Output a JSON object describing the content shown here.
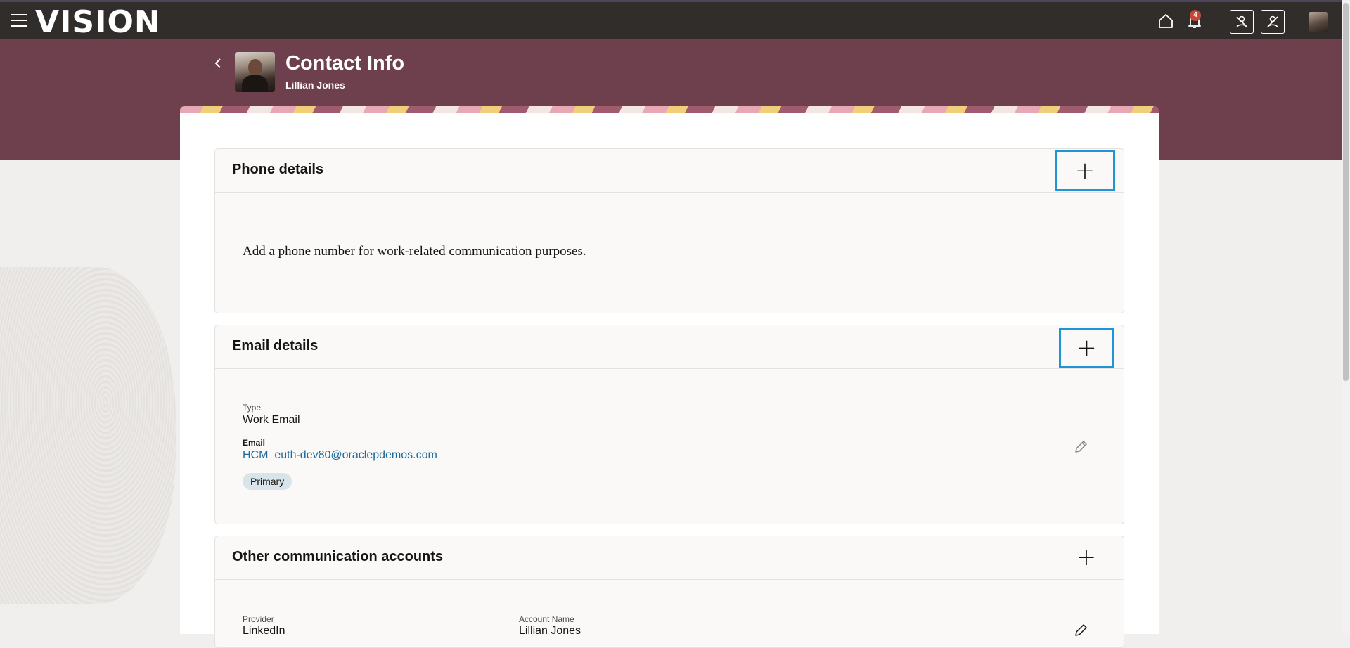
{
  "app": {
    "logo": "VISION",
    "notification_count": "4"
  },
  "header": {
    "title": "Contact Info",
    "person_name": "Lillian Jones"
  },
  "phone": {
    "section_title": "Phone details",
    "empty_message": "Add a phone number for work-related communication purposes."
  },
  "email": {
    "section_title": "Email details",
    "type_label": "Type",
    "type_value": "Work Email",
    "email_label": "Email",
    "email_value": "HCM_euth-dev80@oraclepdemos.com",
    "primary_chip": "Primary"
  },
  "other": {
    "section_title": "Other communication accounts",
    "provider_label": "Provider",
    "provider_value": "LinkedIn",
    "account_label": "Account Name",
    "account_value": "Lillian Jones"
  },
  "icons": [
    "hamburger-icon",
    "home-icon",
    "bell-icon",
    "person-icon",
    "person-off-icon",
    "back-chevron-icon",
    "plus-icon",
    "pencil-icon"
  ],
  "colors": {
    "topbar": "#312d2a",
    "banner": "#6e3f4c",
    "highlight": "#1e95d4",
    "link": "#1c6a9b"
  }
}
